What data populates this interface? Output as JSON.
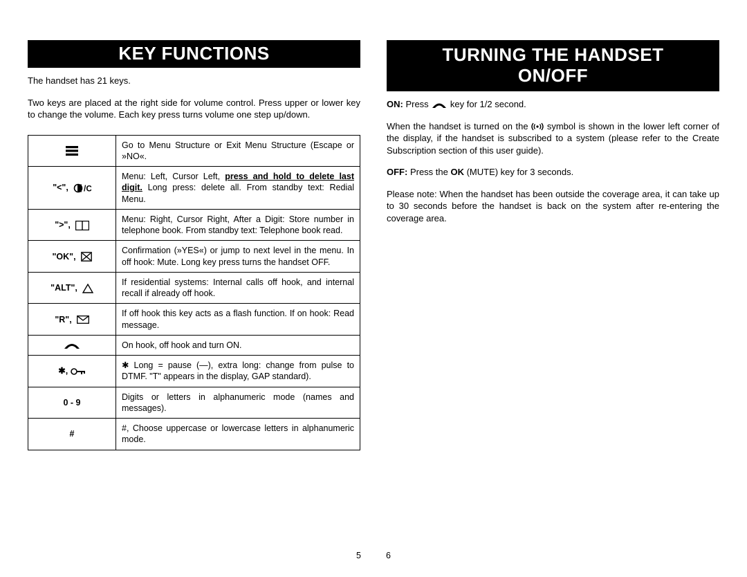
{
  "left": {
    "heading": "KEY FUNCTIONS",
    "p1": "The handset has 21 keys.",
    "p2": "Two keys are placed at the right side for volume control. Press upper or lower key to change the volume. Each key press turns volume one step up/down.",
    "rows": {
      "menu": {
        "desc_a": "Go to Menu Structure or Exit Menu Structure (Escape or »NO«."
      },
      "left": {
        "label": "\"<\",",
        "desc_a": "Menu: Left, Cursor Left, ",
        "desc_u": "press and hold to delete last digit.",
        "desc_b": " Long press: delete all. From standby text: Redial Menu."
      },
      "right": {
        "label": "\">\",",
        "desc_a": "Menu: Right, Cursor Right, After a Digit: Store number in telephone book. From standby text: Telephone book read."
      },
      "ok": {
        "label": "\"OK\",",
        "desc_a": "Confirmation (»YES«) or jump to next level in the menu. In off hook: Mute. Long key press turns the handset OFF."
      },
      "alt": {
        "label": "\"ALT\",",
        "desc_a": "If residential systems: Internal calls off hook, and internal recall if already off hook."
      },
      "r": {
        "label": "\"R\",",
        "desc_a": "If off hook this key acts as a flash function. If on hook: Read message."
      },
      "hook": {
        "desc_a": "On hook, off hook and turn ON."
      },
      "starkey": {
        "label": "✱, ",
        "desc_a": "✱ Long = pause (—), extra long: change from pulse to DTMF. \"T\" appears in the display, GAP standard)."
      },
      "digits": {
        "label": "0 - 9",
        "desc_a": "Digits or letters in alphanumeric mode (names and messages)."
      },
      "hash": {
        "label": "#",
        "desc_a": "#, Choose uppercase or lowercase letters in alphanumeric mode."
      }
    }
  },
  "right": {
    "heading_l1": "TURNING THE HANDSET",
    "heading_l2": "ON/OFF",
    "on_bold": "ON: ",
    "on_a": "Press ",
    "on_b": " key for 1/2 second.",
    "p2a": "When the handset is turned on the ",
    "p2b": " symbol is shown in the lower left corner of the display, if the handset is subscribed to a system (please refer to the Create Subscription section of this user guide).",
    "off_bold": "OFF:",
    "off_a": " Press the ",
    "off_ok": "OK",
    "off_b": " (MUTE) key for 3 seconds.",
    "p4": "Please note: When the handset has been outside the coverage area, it can take up to 30 seconds before the handset is back on the system after re-entering the coverage area."
  },
  "pagenum_left": "5",
  "pagenum_right": "6"
}
